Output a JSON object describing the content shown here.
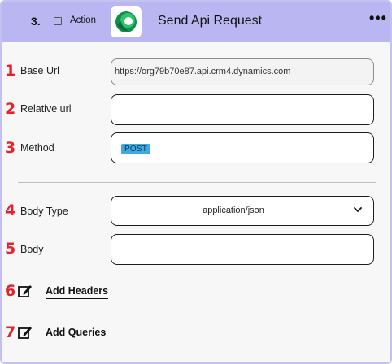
{
  "header": {
    "step_number": "3.",
    "step_type": "Action",
    "title": "Send Api Request",
    "menu_glyph": "•••",
    "logo_icon": "dynamics-365-logo-icon",
    "accent_color": "#b9b6f2"
  },
  "fields": {
    "base_url": {
      "number": "1",
      "label": "Base Url",
      "value": "https://org79b70e87.api.crm4.dynamics.com"
    },
    "relative_url": {
      "number": "2",
      "label": "Relative url",
      "value": ""
    },
    "method": {
      "number": "3",
      "label": "Method",
      "value": "POST"
    },
    "body_type": {
      "number": "4",
      "label": "Body Type",
      "value": "application/json"
    },
    "body": {
      "number": "5",
      "label": "Body",
      "value": ""
    }
  },
  "actions": {
    "add_headers": {
      "number": "6",
      "label": "Add Headers",
      "icon": "edit-icon"
    },
    "add_queries": {
      "number": "7",
      "label": "Add Queries",
      "icon": "edit-icon"
    }
  },
  "colors": {
    "step_number_red": "#e8202a",
    "method_badge": "#3fa9e0"
  }
}
